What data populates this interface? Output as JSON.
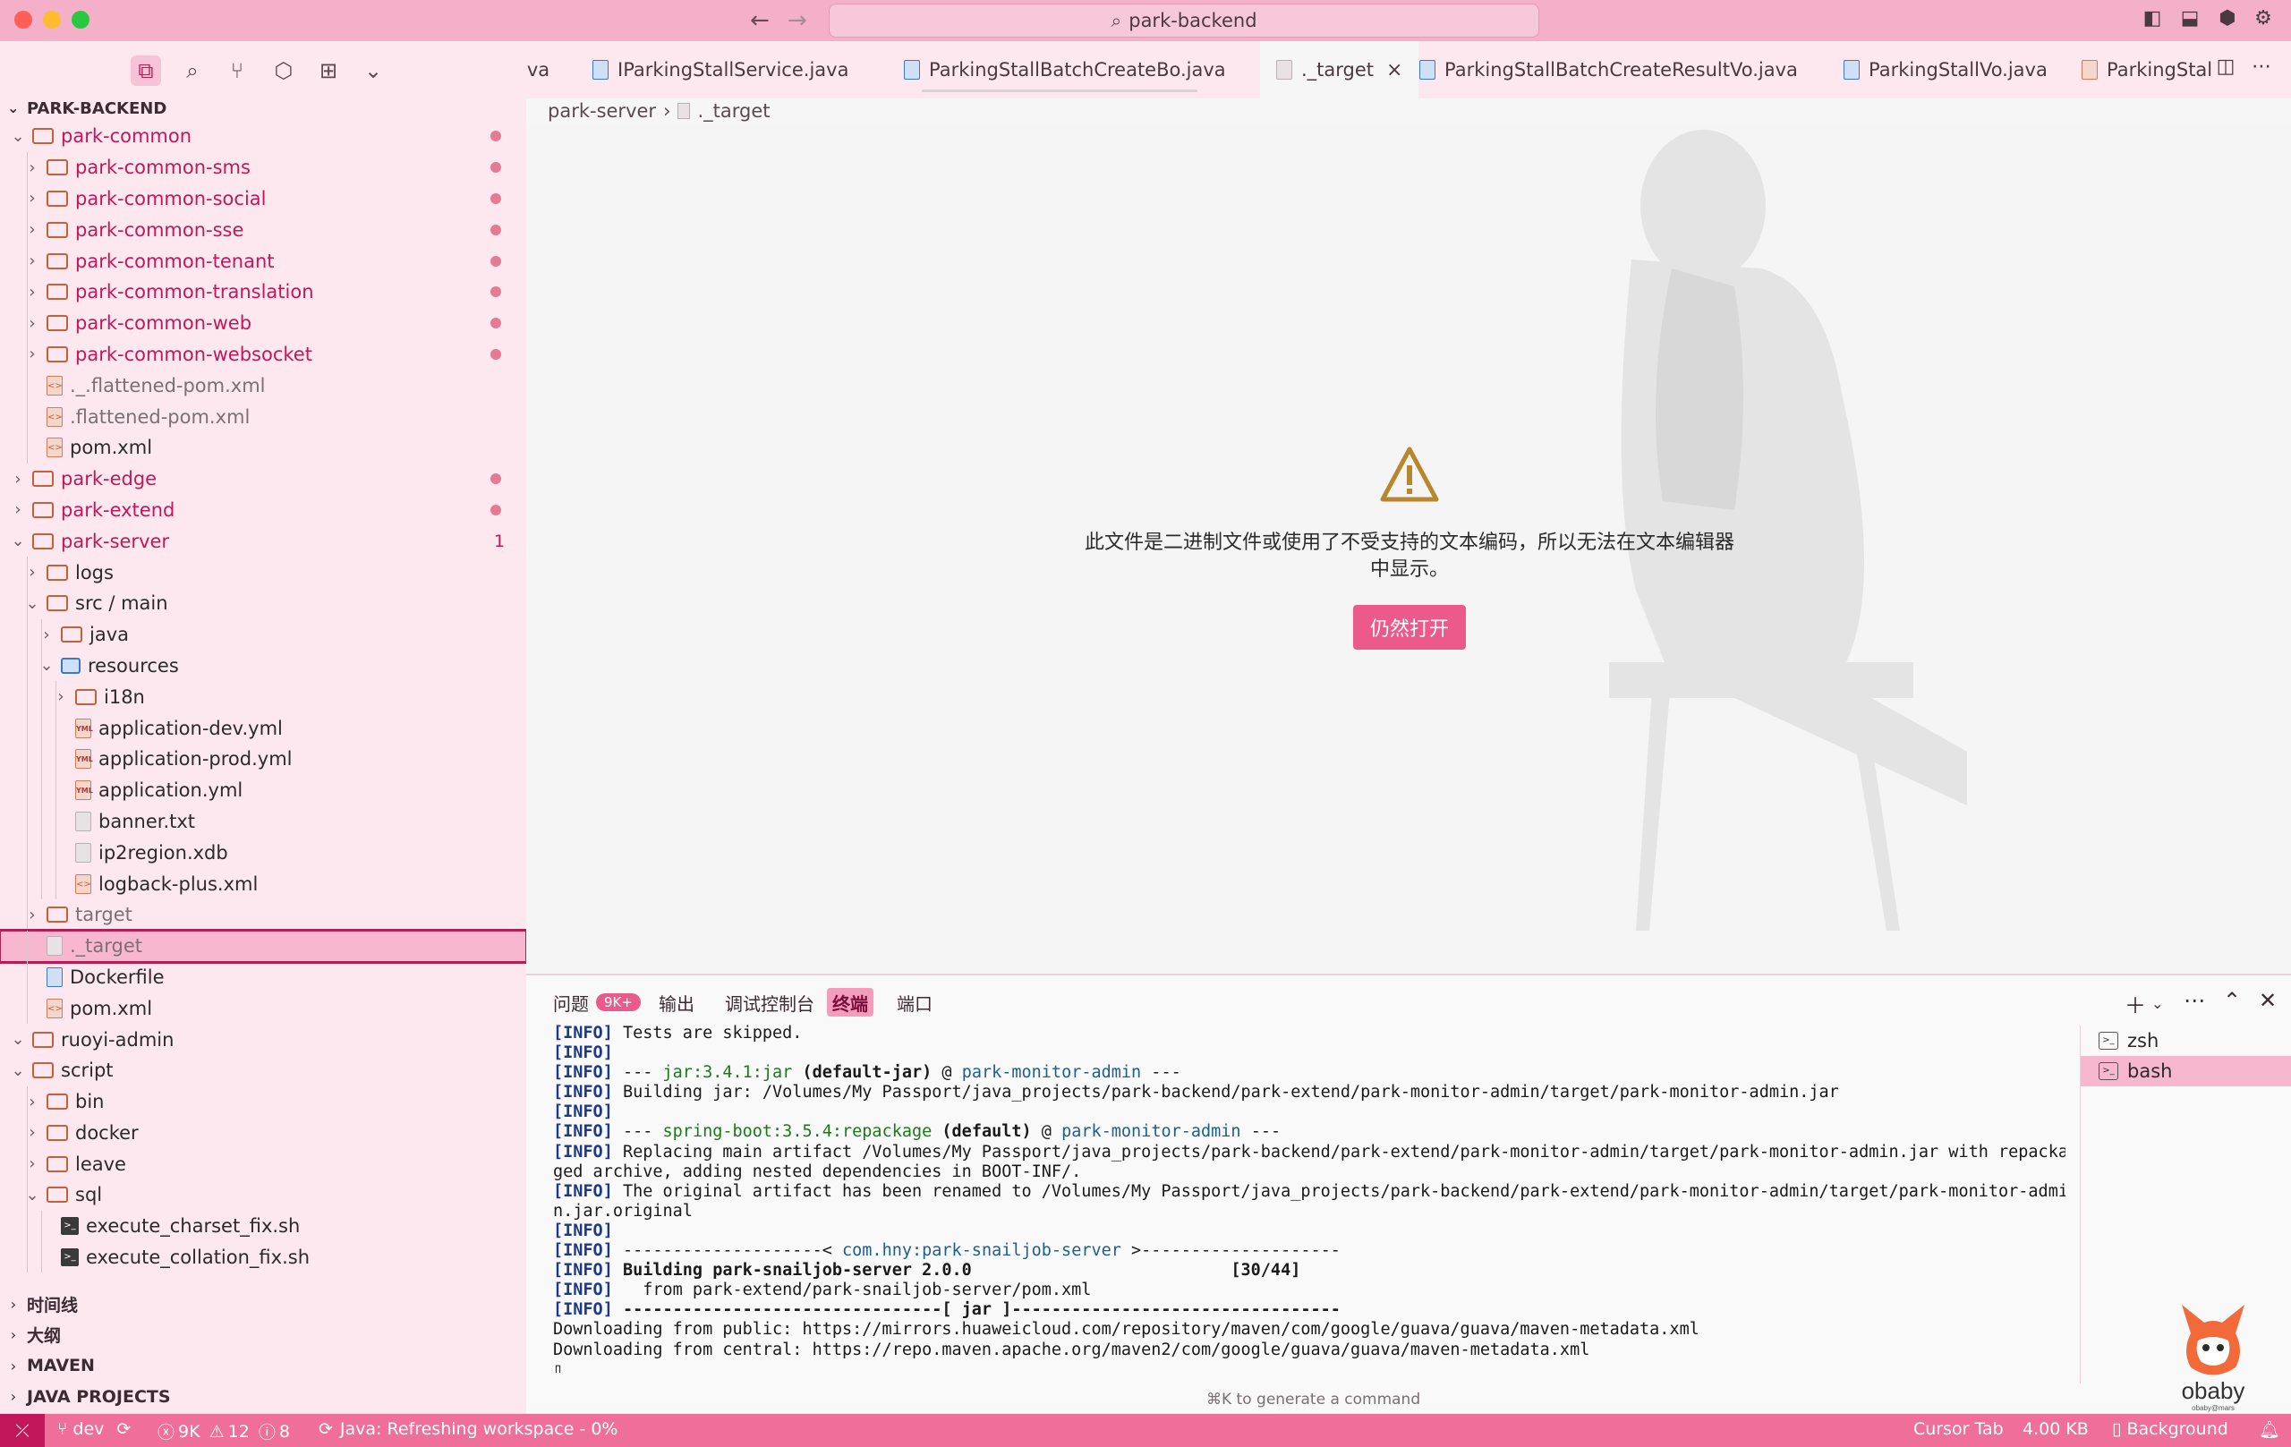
{
  "window": {
    "search_text": "park-backend"
  },
  "sidebar": {
    "root_label": "PARK-BACKEND",
    "tree": [
      {
        "label": "park-common",
        "type": "folder",
        "depth": 0,
        "open": true,
        "color": "red",
        "marker": "dot"
      },
      {
        "label": "park-common-sms",
        "type": "folder",
        "depth": 1,
        "open": false,
        "color": "red",
        "marker": "dot"
      },
      {
        "label": "park-common-social",
        "type": "folder",
        "depth": 1,
        "open": false,
        "color": "red",
        "marker": "dot"
      },
      {
        "label": "park-common-sse",
        "type": "folder",
        "depth": 1,
        "open": false,
        "color": "red",
        "marker": "dot"
      },
      {
        "label": "park-common-tenant",
        "type": "folder",
        "depth": 1,
        "open": false,
        "color": "red",
        "marker": "dot"
      },
      {
        "label": "park-common-translation",
        "type": "folder",
        "depth": 1,
        "open": false,
        "color": "red",
        "marker": "dot"
      },
      {
        "label": "park-common-web",
        "type": "folder",
        "depth": 1,
        "open": false,
        "color": "red",
        "marker": "dot"
      },
      {
        "label": "park-common-websocket",
        "type": "folder",
        "depth": 1,
        "open": false,
        "color": "red",
        "marker": "dot"
      },
      {
        "label": "._.flattened-pom.xml",
        "type": "xml",
        "depth": 1,
        "color": "gray"
      },
      {
        "label": ".flattened-pom.xml",
        "type": "xml",
        "depth": 1,
        "color": "gray"
      },
      {
        "label": "pom.xml",
        "type": "xml",
        "depth": 1
      },
      {
        "label": "park-edge",
        "type": "folder",
        "depth": 0,
        "open": false,
        "color": "red",
        "marker": "dot"
      },
      {
        "label": "park-extend",
        "type": "folder",
        "depth": 0,
        "open": false,
        "color": "red",
        "marker": "dot"
      },
      {
        "label": "park-server",
        "type": "folder",
        "depth": 0,
        "open": true,
        "color": "red",
        "marker": "1"
      },
      {
        "label": "logs",
        "type": "folder",
        "depth": 1,
        "open": false
      },
      {
        "label": "src / main",
        "type": "folder",
        "depth": 1,
        "open": true
      },
      {
        "label": "java",
        "type": "folder",
        "depth": 2,
        "open": false
      },
      {
        "label": "resources",
        "type": "res",
        "depth": 2,
        "open": true
      },
      {
        "label": "i18n",
        "type": "folder",
        "depth": 3,
        "open": false
      },
      {
        "label": "application-dev.yml",
        "type": "yml",
        "depth": 3
      },
      {
        "label": "application-prod.yml",
        "type": "yml",
        "depth": 3
      },
      {
        "label": "application.yml",
        "type": "yml",
        "depth": 3
      },
      {
        "label": "banner.txt",
        "type": "file",
        "depth": 3
      },
      {
        "label": "ip2region.xdb",
        "type": "file",
        "depth": 3
      },
      {
        "label": "logback-plus.xml",
        "type": "xml",
        "depth": 3
      },
      {
        "label": "target",
        "type": "folder",
        "depth": 1,
        "open": false,
        "color": "gray"
      },
      {
        "label": "._target",
        "type": "file",
        "depth": 1,
        "selected": true,
        "color": "gray"
      },
      {
        "label": "Dockerfile",
        "type": "docker",
        "depth": 1
      },
      {
        "label": "pom.xml",
        "type": "xml",
        "depth": 1
      },
      {
        "label": "ruoyi-admin",
        "type": "folder",
        "depth": 0,
        "open": true
      },
      {
        "label": "script",
        "type": "folder",
        "depth": 0,
        "open": true
      },
      {
        "label": "bin",
        "type": "folder",
        "depth": 1,
        "open": false
      },
      {
        "label": "docker",
        "type": "folder",
        "depth": 1,
        "open": false
      },
      {
        "label": "leave",
        "type": "folder",
        "depth": 1,
        "open": false
      },
      {
        "label": "sql",
        "type": "folder",
        "depth": 1,
        "open": true
      },
      {
        "label": "execute_charset_fix.sh",
        "type": "sh",
        "depth": 2
      },
      {
        "label": "execute_collation_fix.sh",
        "type": "sh",
        "depth": 2
      }
    ],
    "sections": [
      "时间线",
      "大纲",
      "MAVEN",
      "JAVA PROJECTS"
    ]
  },
  "tabs": [
    {
      "label": "ava"
    },
    {
      "label": "IParkingStallService.java"
    },
    {
      "label": "ParkingStallBatchCreateBo.java"
    },
    {
      "label": "._target",
      "active": true
    },
    {
      "label": "ParkingStallBatchCreateResultVo.java"
    },
    {
      "label": "ParkingStallVo.java"
    },
    {
      "label": "ParkingStal"
    }
  ],
  "breadcrumb": {
    "folder": "park-server",
    "file": "._target"
  },
  "editor": {
    "message": "此文件是二进制文件或使用了不受支持的文本编码，所以无法在文本编辑器中显示。",
    "open_anyway": "仍然打开"
  },
  "panel": {
    "tabs": {
      "problems": "问题",
      "problems_badge": "9K+",
      "output": "输出",
      "debug_console": "调试控制台",
      "terminal": "终端",
      "ports": "端口"
    },
    "terminals": [
      "zsh",
      "bash"
    ],
    "cmdk_hint": "⌘K to generate a command",
    "logo_text": "obaby",
    "logo_sub": "obaby@mars",
    "lines": [
      {
        "pre": "[INFO]",
        "segs": [
          {
            "t": " Tests are skipped."
          }
        ]
      },
      {
        "pre": "[INFO]",
        "segs": []
      },
      {
        "pre": "[INFO]",
        "segs": [
          {
            "t": " --- "
          },
          {
            "t": "jar:3.4.1:jar",
            "c": "green"
          },
          {
            "t": " (default-jar)",
            "c": "bold"
          },
          {
            "t": " @ "
          },
          {
            "t": "park-monitor-admin",
            "c": "blue"
          },
          {
            "t": " ---"
          }
        ]
      },
      {
        "pre": "[INFO]",
        "segs": [
          {
            "t": " Building jar: /Volumes/My Passport/java_projects/park-backend/park-extend/park-monitor-admin/target/park-monitor-admin.jar"
          }
        ]
      },
      {
        "pre": "[INFO]",
        "segs": []
      },
      {
        "pre": "[INFO]",
        "segs": [
          {
            "t": " --- "
          },
          {
            "t": "spring-boot:3.5.4:repackage",
            "c": "green"
          },
          {
            "t": " (default)",
            "c": "bold"
          },
          {
            "t": " @ "
          },
          {
            "t": "park-monitor-admin",
            "c": "blue"
          },
          {
            "t": " ---"
          }
        ]
      },
      {
        "pre": "[INFO]",
        "segs": [
          {
            "t": " Replacing main artifact /Volumes/My Passport/java_projects/park-backend/park-extend/park-monitor-admin/target/park-monitor-admin.jar with repacka"
          }
        ]
      },
      {
        "pre": "",
        "segs": [
          {
            "t": "ged archive, adding nested dependencies in BOOT-INF/."
          }
        ]
      },
      {
        "pre": "[INFO]",
        "segs": [
          {
            "t": " The original artifact has been renamed to /Volumes/My Passport/java_projects/park-backend/park-extend/park-monitor-admin/target/park-monitor-admi"
          }
        ]
      },
      {
        "pre": "",
        "segs": [
          {
            "t": "n.jar.original"
          }
        ]
      },
      {
        "pre": "[INFO]",
        "segs": []
      },
      {
        "pre": "[INFO]",
        "segs": [
          {
            "t": " --------------------< "
          },
          {
            "t": "com.hny:park-snailjob-server",
            "c": "blue"
          },
          {
            "t": " >--------------------"
          }
        ]
      },
      {
        "pre": "[INFO]",
        "segs": [
          {
            "t": " Building park-snailjob-server 2.0.0                          [30/44]",
            "c": "bold"
          }
        ]
      },
      {
        "pre": "[INFO]",
        "segs": [
          {
            "t": "   from park-extend/park-snailjob-server/pom.xml"
          }
        ]
      },
      {
        "pre": "[INFO]",
        "segs": [
          {
            "t": " --------------------------------[ jar ]---------------------------------",
            "c": "bold"
          }
        ]
      },
      {
        "pre": "",
        "segs": [
          {
            "t": "Downloading from public: https://mirrors.huaweicloud.com/repository/maven/com/google/guava/guava/maven-metadata.xml"
          }
        ]
      },
      {
        "pre": "",
        "segs": [
          {
            "t": "Downloading from central: https://repo.maven.apache.org/maven2/com/google/guava/guava/maven-metadata.xml"
          }
        ]
      },
      {
        "pre": "",
        "segs": [
          {
            "t": "▯"
          }
        ]
      }
    ]
  },
  "statusbar": {
    "branch": "dev",
    "errors": "9K",
    "warnings": "12",
    "infos": "8",
    "java_status": "Java: Refreshing workspace - 0%",
    "cursor_tab": "Cursor Tab",
    "file_size": "4.00 KB",
    "background": "Background"
  },
  "colors": {
    "accent": "#ec5a8c",
    "titlebar": "#f3b0c8",
    "sidebar": "#fde8f0",
    "statusbar": "#ef6f9a",
    "selected_outline": "#b01f55"
  }
}
